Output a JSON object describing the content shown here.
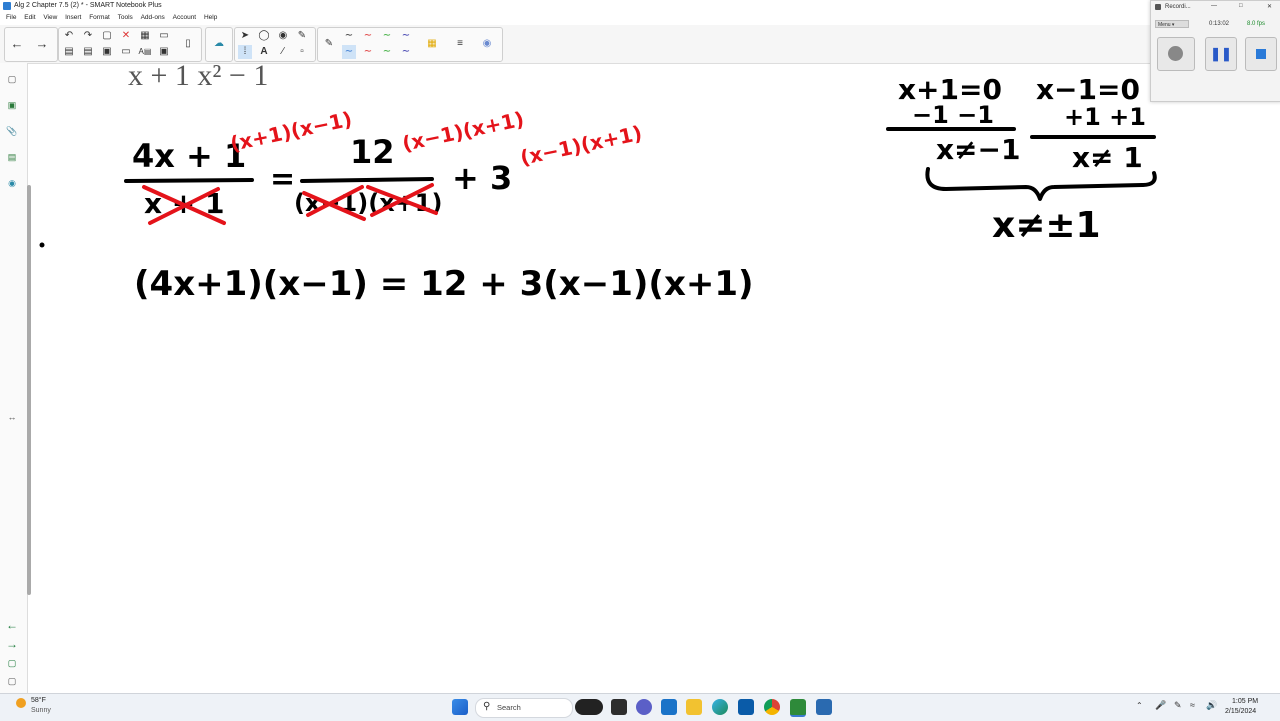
{
  "window": {
    "title": "Alg 2 Chapter 7.5 (2) * - SMART Notebook Plus"
  },
  "menu": {
    "items": [
      "File",
      "Edit",
      "View",
      "Insert",
      "Format",
      "Tools",
      "Add-ons",
      "Account",
      "Help"
    ]
  },
  "recorder": {
    "title": "Recordi...",
    "menu_label": "Menu",
    "time": "0:13:02",
    "fps": "8.0 fps"
  },
  "canvas": {
    "top_partial": "x + 1        x² − 1",
    "eq1_left_num": "4x + 1",
    "eq1_left_den": "x + 1",
    "eq1_mult_left": "(x+1)(x−1)",
    "eq1_equals": "=",
    "eq1_right_num": "12",
    "eq1_mult_right": "(x−1)(x+1)",
    "eq1_right_den": "(x−1)(x+1)",
    "eq1_plus3": "+ 3",
    "eq1_mult_three": "(x−1)(x+1)",
    "eq2": "(4x+1)(x−1) = 12 + 3(x−1)(x+1)",
    "side_a_eq": "x+1=0",
    "side_a_sub": "−1  −1",
    "side_a_res": "x≠−1",
    "side_b_eq": "x−1=0",
    "side_b_add": "+1 +1",
    "side_b_res": "x≠ 1",
    "side_final": "x≠±1"
  },
  "taskbar": {
    "weather_temp": "58°F",
    "weather_desc": "Sunny",
    "search_placeholder": "Search",
    "time": "1:05 PM",
    "date": "2/15/2024"
  },
  "colors": {
    "ink": "#000000",
    "red_ink": "#e4131a",
    "taskbar": "#eef2f7"
  }
}
